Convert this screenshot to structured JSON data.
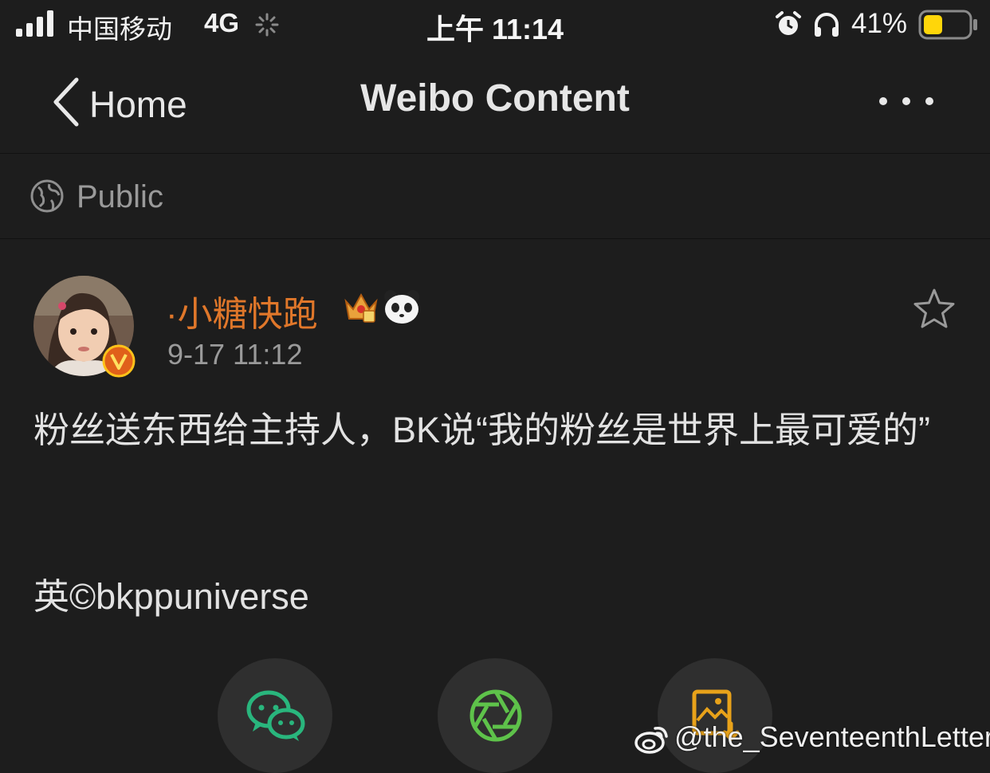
{
  "status_bar": {
    "carrier": "中国移动",
    "network": "4G",
    "time": "上午 11:14",
    "battery_percent": "41%",
    "battery_level": 0.41,
    "battery_color": "#ffd60a"
  },
  "nav": {
    "back_label": "Home",
    "title": "Weibo Content"
  },
  "visibility": {
    "label": "Public"
  },
  "post": {
    "username": "·小糖快跑",
    "username_color": "#e0772a",
    "timestamp": "9-17 11:12",
    "text": "粉丝送东西给主持人，BK说“我的粉丝是世界上最可爱的”",
    "credit": "英©bkppuniverse"
  },
  "share_buttons": [
    {
      "icon": "wechat-icon",
      "color": "#29b67d"
    },
    {
      "icon": "moments-icon",
      "color": "#5ec24a"
    },
    {
      "icon": "save-image-icon",
      "color": "#e8a21a"
    }
  ],
  "watermark": {
    "text": "@the_SeventeenthLetter"
  }
}
